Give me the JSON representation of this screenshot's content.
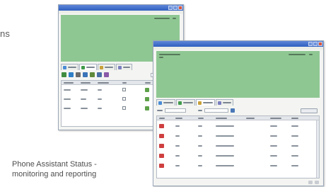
{
  "left_fragment": "ns",
  "caption": {
    "line1": "Phone Assistant Status -",
    "line2": "monitoring and reporting"
  },
  "colors": {
    "titlebar": "#3a68c8",
    "status_green": "#8fc793",
    "window_bg": "#f4f5f2"
  },
  "icons": {
    "phone_row_icon": "phone-icon",
    "status_indicator": "green-status-icon"
  }
}
